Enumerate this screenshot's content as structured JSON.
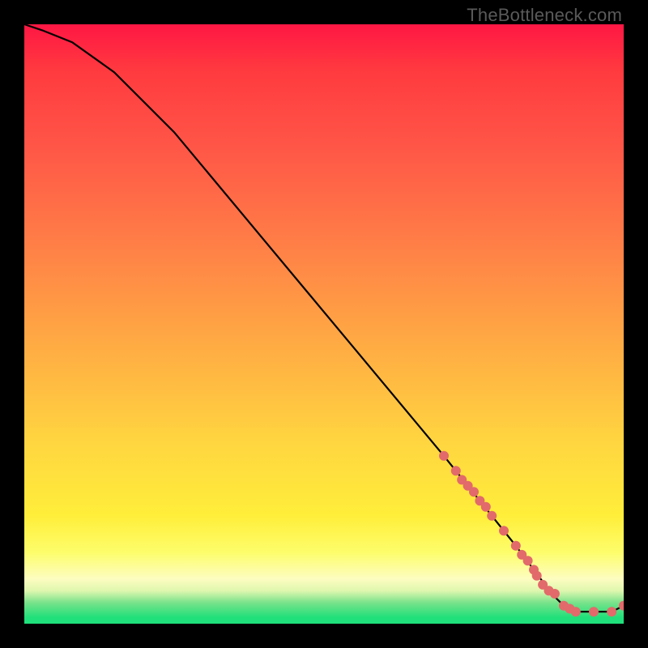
{
  "attribution": "TheBottleneck.com",
  "chart_data": {
    "type": "line",
    "title": "",
    "xlabel": "",
    "ylabel": "",
    "xlim": [
      0,
      100
    ],
    "ylim": [
      0,
      100
    ],
    "x": [
      0,
      3,
      8,
      15,
      25,
      40,
      55,
      70,
      78,
      82,
      85,
      88,
      90,
      92,
      94,
      96,
      98,
      100
    ],
    "values": [
      100,
      99,
      97,
      92,
      82,
      64,
      46,
      28,
      18,
      13,
      9,
      5,
      3,
      2,
      2,
      2,
      2,
      3
    ],
    "series": [
      {
        "name": "markers",
        "x": [
          70,
          72,
          73,
          74,
          75,
          76,
          77,
          78,
          80,
          82,
          83,
          84,
          85,
          85.5,
          86.5,
          87.5,
          88.5,
          90,
          91,
          92,
          95,
          98,
          100
        ],
        "values": [
          28,
          25.5,
          24,
          23,
          22,
          20.5,
          19.5,
          18,
          15.5,
          13,
          11.5,
          10.5,
          9,
          8,
          6.5,
          5.5,
          5,
          3,
          2.5,
          2,
          2,
          2,
          3
        ]
      }
    ],
    "colors": {
      "line": "#000000",
      "marker": "#e26a6a"
    }
  }
}
